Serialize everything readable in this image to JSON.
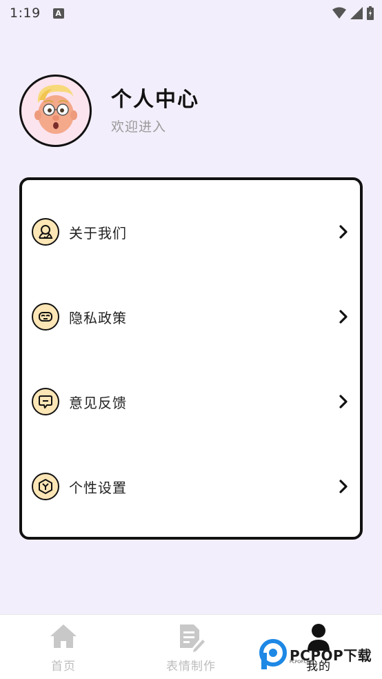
{
  "status_bar": {
    "time": "1:19",
    "notification_icon": "A"
  },
  "profile": {
    "title": "个人中心",
    "subtitle": "欢迎进入",
    "avatar_icon": "cartoon-avatar"
  },
  "menu": {
    "items": [
      {
        "label": "关于我们",
        "icon": "person-outline-icon"
      },
      {
        "label": "隐私政策",
        "icon": "mask-icon"
      },
      {
        "label": "意见反馈",
        "icon": "chat-bubble-icon"
      },
      {
        "label": "个性设置",
        "icon": "hexagon-y-icon"
      }
    ]
  },
  "bottom_nav": {
    "tabs": [
      {
        "label": "首页",
        "icon": "home-icon",
        "active": false
      },
      {
        "label": "表情制作",
        "icon": "document-edit-icon",
        "active": false
      },
      {
        "label": "我的",
        "icon": "person-icon",
        "active": true
      }
    ]
  },
  "watermark": {
    "brand": "PCPOP下载",
    "small": "PCPOP.COM"
  },
  "colors": {
    "background": "#f3eefb",
    "icon_fill": "#fde6b6",
    "avatar_bg": "#fbe4ee"
  }
}
